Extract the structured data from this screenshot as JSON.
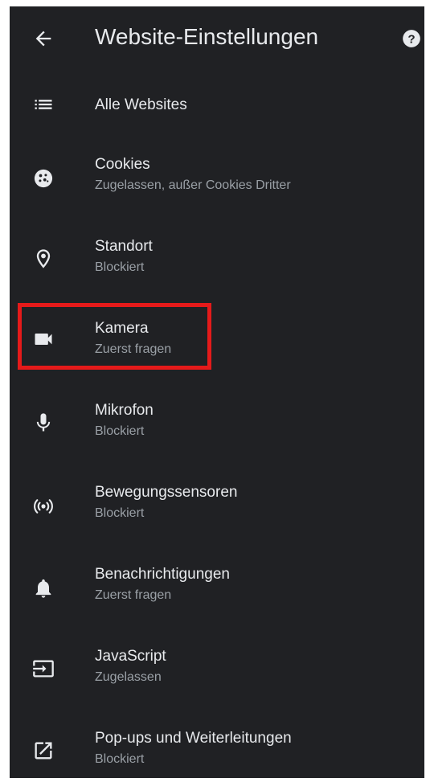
{
  "header": {
    "title": "Website-Einstellungen",
    "back_icon": "arrow-back-icon",
    "help_icon": "help-icon"
  },
  "items": [
    {
      "label": "Alle Websites",
      "sub": "",
      "icon": "list-icon"
    },
    {
      "label": "Cookies",
      "sub": "Zugelassen, außer Cookies Dritter",
      "icon": "cookie-icon"
    },
    {
      "label": "Standort",
      "sub": "Blockiert",
      "icon": "location-pin-icon"
    },
    {
      "label": "Kamera",
      "sub": "Zuerst fragen",
      "icon": "videocam-icon"
    },
    {
      "label": "Mikrofon",
      "sub": "Blockiert",
      "icon": "microphone-icon"
    },
    {
      "label": "Bewegungssensoren",
      "sub": "Blockiert",
      "icon": "sensors-icon"
    },
    {
      "label": "Benachrichtigungen",
      "sub": "Zuerst fragen",
      "icon": "bell-icon"
    },
    {
      "label": "JavaScript",
      "sub": "Zugelassen",
      "icon": "javascript-icon"
    },
    {
      "label": "Pop-ups und Weiterleitungen",
      "sub": "Blockiert",
      "icon": "open-in-new-icon"
    }
  ],
  "colors": {
    "background": "#202124",
    "text_primary": "#e8eaed",
    "text_secondary": "#9aa0a6",
    "highlight_border": "#e51a1a"
  }
}
